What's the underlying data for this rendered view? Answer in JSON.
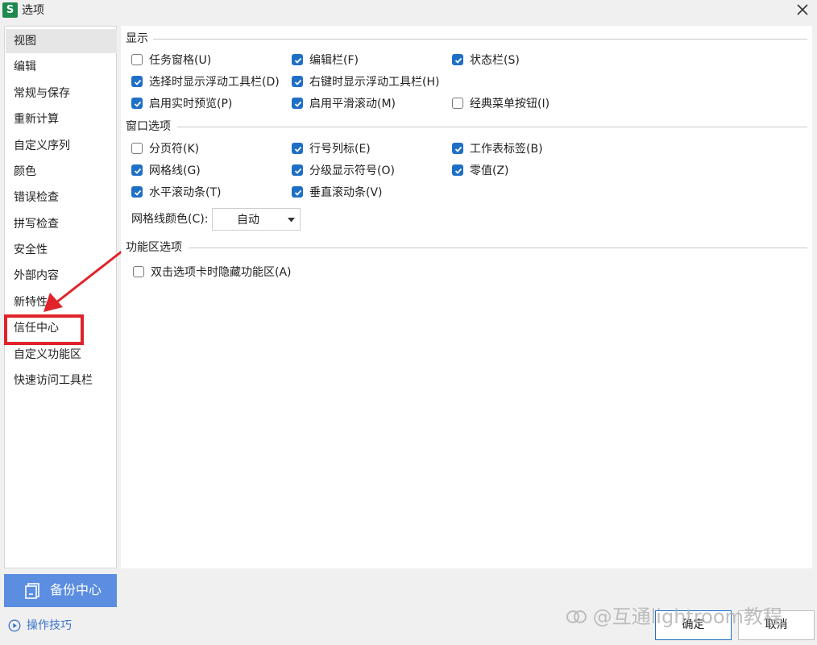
{
  "window": {
    "title": "选项",
    "app_icon_letter": "S"
  },
  "sidebar": {
    "items": [
      {
        "label": "视图",
        "selected": true
      },
      {
        "label": "编辑"
      },
      {
        "label": "常规与保存"
      },
      {
        "label": "重新计算"
      },
      {
        "label": "自定义序列"
      },
      {
        "label": "颜色"
      },
      {
        "label": "错误检查"
      },
      {
        "label": "拼写检查"
      },
      {
        "label": "安全性"
      },
      {
        "label": "外部内容"
      },
      {
        "label": "新特性"
      },
      {
        "label": "信任中心"
      },
      {
        "label": "自定义功能区"
      },
      {
        "label": "快速访问工具栏"
      }
    ]
  },
  "backup_button": {
    "label": "备份中心"
  },
  "tips_link": {
    "label": "操作技巧"
  },
  "display": {
    "title": "显示",
    "options": [
      {
        "label": "任务窗格(U)",
        "checked": false
      },
      {
        "label": "编辑栏(F)",
        "checked": true
      },
      {
        "label": "状态栏(S)",
        "checked": true
      },
      {
        "label": "选择时显示浮动工具栏(D)",
        "checked": true
      },
      {
        "label": "右键时显示浮动工具栏(H)",
        "checked": true
      },
      {
        "label": "启用实时预览(P)",
        "checked": true
      },
      {
        "label": "启用平滑滚动(M)",
        "checked": true
      },
      {
        "label": "经典菜单按钮(I)",
        "checked": false
      }
    ]
  },
  "window_options": {
    "title": "窗口选项",
    "options": [
      {
        "label": "分页符(K)",
        "checked": false
      },
      {
        "label": "行号列标(E)",
        "checked": true
      },
      {
        "label": "工作表标签(B)",
        "checked": true
      },
      {
        "label": "网格线(G)",
        "checked": true
      },
      {
        "label": "分级显示符号(O)",
        "checked": true
      },
      {
        "label": "零值(Z)",
        "checked": true
      },
      {
        "label": "水平滚动条(T)",
        "checked": true
      },
      {
        "label": "垂直滚动条(V)",
        "checked": true
      }
    ],
    "gridline_color_label": "网格线颜色(C):",
    "gridline_color_value": "自动"
  },
  "ribbon_options": {
    "title": "功能区选项",
    "options": [
      {
        "label": "双击选项卡时隐藏功能区(A)",
        "checked": false
      }
    ]
  },
  "footer": {
    "ok_label": "确定",
    "cancel_label": "取消"
  },
  "watermark": "互通lightroom教程",
  "colors": {
    "accent": "#1f6fc6",
    "backup_bg": "#5b8de0",
    "highlight": "#e0232a"
  }
}
